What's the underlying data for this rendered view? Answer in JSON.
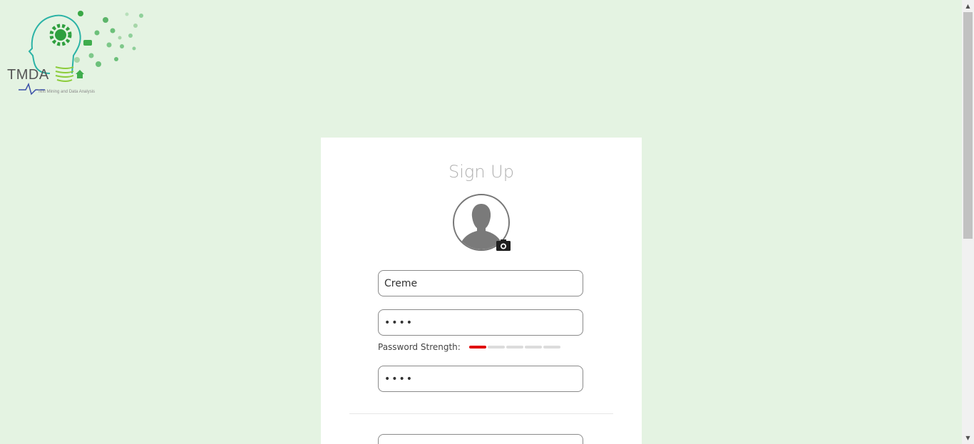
{
  "logo": {
    "title": "TMDA",
    "subtitle": "Text Mining and Data Analysis"
  },
  "form": {
    "title": "Sign Up",
    "username_value": "Creme",
    "password_value": "••••",
    "password_strength_label": "Password Strength:",
    "password_strength_level": 0.2,
    "confirm_password_value": "••••"
  },
  "colors": {
    "background": "#e4f3e2",
    "strength_active": "#e00000",
    "logo_green": "#2db34a"
  },
  "icons": {
    "avatar": "user-silhouette-icon",
    "camera": "camera-icon"
  }
}
